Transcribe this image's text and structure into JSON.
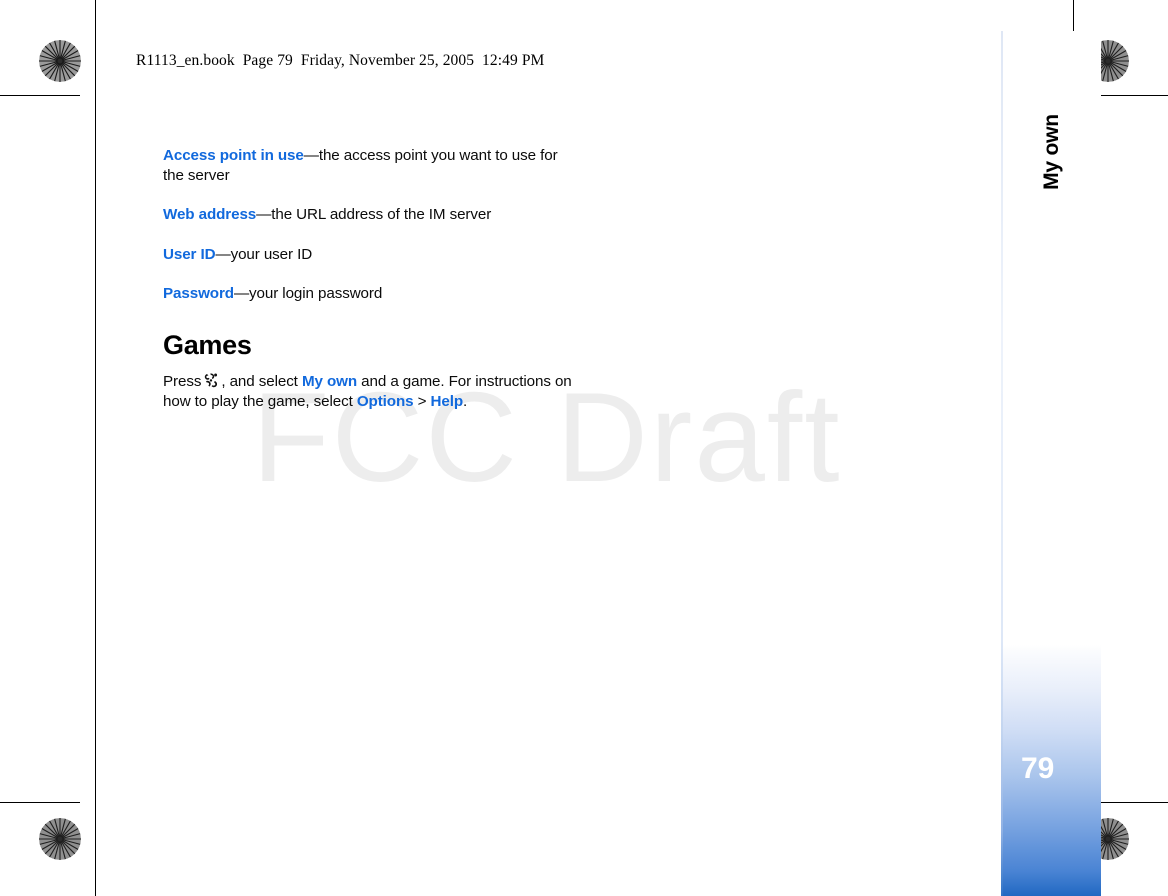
{
  "book_header": "R1113_en.book  Page 79  Friday, November 25, 2005  12:49 PM",
  "watermark": "FCC Draft",
  "side_tab": {
    "label": "My own",
    "page_number": "79",
    "gradient_top_color": "#ffffff",
    "gradient_bottom_color": "#2168c2"
  },
  "colors": {
    "link_blue": "#1169dd",
    "body_text": "#0b0b0b",
    "watermark_gray": "#ededed"
  },
  "content": {
    "settings_list": [
      {
        "term": "Access point in use",
        "description": "—the access point you want to use for the server"
      },
      {
        "term": "Web address",
        "description": "—the URL address of the IM server"
      },
      {
        "term": "User ID",
        "description": "—your user ID"
      },
      {
        "term": "Password",
        "description": "—your login password"
      }
    ],
    "games_section": {
      "heading": "Games",
      "sentence_part1": "Press",
      "menu_key_icon": "menu-key-icon",
      "sentence_part2": ", and select",
      "ui_my_own": "My own",
      "sentence_part3": "and a game. For instructions on how to play the game, select",
      "ui_options": "Options",
      "separator": ">",
      "ui_help": "Help",
      "sentence_end": "."
    }
  }
}
